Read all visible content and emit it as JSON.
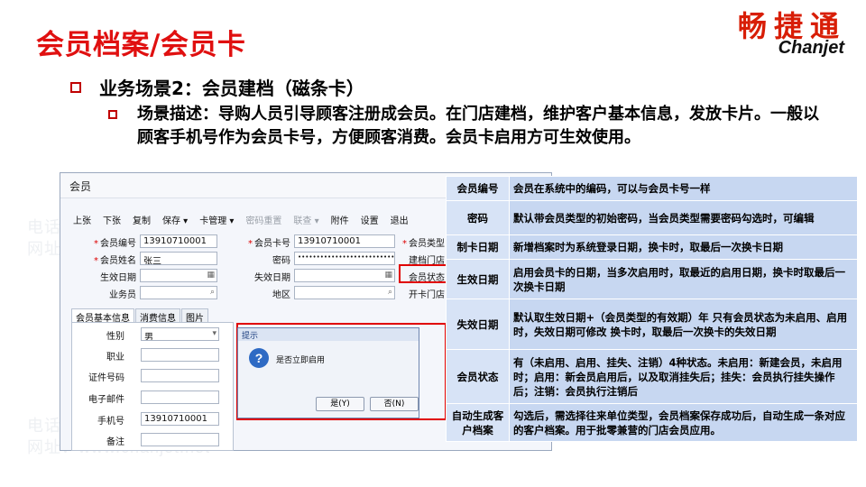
{
  "slide": {
    "title": "会员档案/会员卡",
    "logo": {
      "cn": "畅捷通",
      "en": "Chanjet"
    },
    "watermark": {
      "phone": "电话：400-665-0028",
      "site": "网址：www.chanjet.net"
    },
    "bullet1": "业务场景2：会员建档（磁条卡）",
    "bullet2": "场景描述：导购人员引导顾客注册成会员。在门店建档，维护客户基本信息，发放卡片。一般以顾客手机号作为会员卡号，方便顾客消费。会员卡启用方可生效使用。"
  },
  "window": {
    "title": "会员",
    "toolbar": [
      "上张",
      "下张",
      "复制",
      "保存 ▾",
      "卡管理 ▾",
      "密码重置",
      "联查 ▾",
      "附件",
      "设置",
      "退出"
    ],
    "fields": {
      "member_no_label": "会员编号",
      "member_no_value": "13910710001",
      "member_name_label": "会员姓名",
      "member_name_value": "张三",
      "effective_label": "生效日期",
      "salesperson_label": "业务员",
      "card_no_label": "会员卡号",
      "card_no_value": "13910710001",
      "password_label": "密码",
      "password_value": "••••••••••••••••••••••••••••",
      "expire_label": "失效日期",
      "region_label": "地区",
      "member_type_label": "会员类型",
      "create_store_label": "建档门店",
      "status_label": "会员状态",
      "card_store_label": "开卡门店"
    },
    "tabs": [
      "会员基本信息",
      "消费信息",
      "图片"
    ],
    "basic": {
      "gender_label": "性别",
      "gender_value": "男",
      "job_label": "职业",
      "id_label": "证件号码",
      "email_label": "电子邮件",
      "mobile_label": "手机号",
      "mobile_value": "13910710001",
      "remark_label": "备注"
    },
    "dialog": {
      "title": "提示",
      "message": "是否立即启用",
      "yes": "是(Y)",
      "no": "否(N)"
    }
  },
  "desc_table": [
    {
      "key": "会员编号",
      "value": "会员在系统中的编码，可以与会员卡号一样"
    },
    {
      "key": "密码",
      "value": "默认带会员类型的初始密码，当会员类型需要密码勾选时，可编辑"
    },
    {
      "key": "制卡日期",
      "value": "新增档案时为系统登录日期，换卡时，取最后一次换卡日期"
    },
    {
      "key": "生效日期",
      "value": "启用会员卡的日期，当多次启用时，取最近的启用日期，换卡时取最后一次换卡日期"
    },
    {
      "key": "失效日期",
      "value": "默认取生效日期+（会员类型的有效期）年 只有会员状态为未启用、启用时，失效日期可修改 换卡时，取最后一次换卡的失效日期"
    },
    {
      "key": "会员状态",
      "value": "有（未启用、启用、挂失、注销）4种状态。未启用：新建会员，未启用时；启用：新会员启用后，以及取消挂失后；挂失：会员执行挂失操作后；注销：会员执行注销后"
    },
    {
      "key": "自动生成客户档案",
      "value": "勾选后，需选择往来单位类型，会员档案保存成功后，自动生成一条对应的客户档案。用于批零兼营的门店会员应用。"
    }
  ],
  "colors": {
    "title_red": "#e01010",
    "table_key_bg": "#d7e3f6",
    "table_value_bg": "#c7d7f1",
    "highlight_red": "#e00000"
  }
}
